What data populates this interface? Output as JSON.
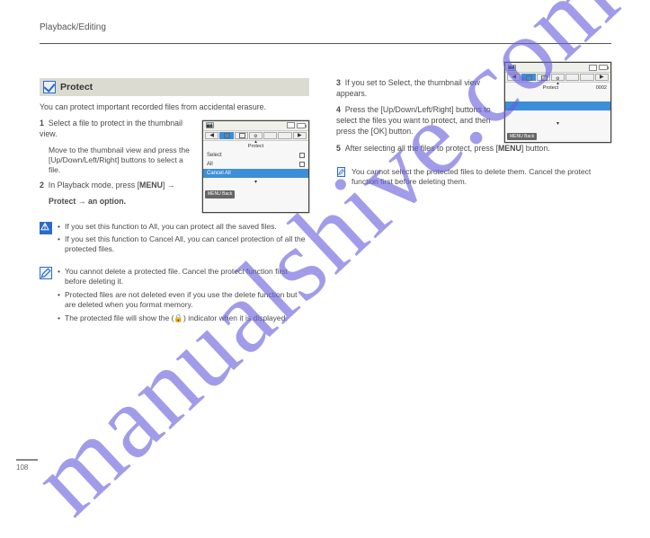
{
  "watermark": "manualshive.com",
  "header": "Playback/Editing",
  "page_number": "108",
  "left": {
    "section_title": "Protect",
    "intro": "You can protect important recorded files from accidental erasure.",
    "step1": "Select a file to protect in the thumbnail view.",
    "step1_sub": "Move to the thumbnail view and press the [Up/Down/Left/Right] buttons to select a file.",
    "step2_prefix": "In Playback mode, press [",
    "step2_mid": "] →",
    "step2_suffix": "Protect → an option.",
    "menu1": {
      "headerText": "Protect",
      "items": [
        {
          "label": "Select",
          "icon": "folder"
        },
        {
          "label": "All",
          "icon": "stack"
        },
        {
          "label": "Cancel All",
          "icon": "",
          "selected": true
        }
      ],
      "footer": "MENU Back",
      "sd_label": "SD"
    },
    "caution_items": [
      "If you set this function to All, you can protect all the saved files.",
      "If you set this function to Cancel All, you can cancel protection of all the protected files."
    ],
    "note_items": [
      "You cannot delete a protected file. Cancel the protect function first before deleting it.",
      "Protected files are not deleted even if you use the delete function but are deleted when you format memory.",
      "The protected file will show the (🔒) indicator when it is displayed."
    ]
  },
  "right": {
    "step3": "If you set to Select, the thumbnail view appears.",
    "step4": "Press the [Up/Down/Left/Right] buttons to select the files you want to protect, and then press the [OK] button.",
    "step5_prefix": "After selecting all the files to protect, press [",
    "step5_suffix": "] button.",
    "menu2": {
      "headerText": "Protect",
      "items": [
        {
          "label": "",
          "selected": false
        },
        {
          "label": "",
          "selected": true
        },
        {
          "label": "",
          "selected": false
        }
      ],
      "rightInfo": "0002",
      "footer": "MENU Back",
      "sd_label": "SD"
    },
    "note2": "You cannot select the protected files to delete them. Cancel the protect function first before deleting them."
  }
}
